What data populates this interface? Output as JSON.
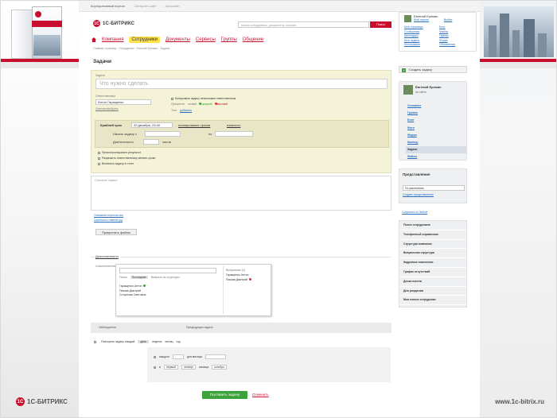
{
  "topbar": [
    "Корпоративный портал",
    "Интернет-сайт",
    "Экстранет"
  ],
  "logo": {
    "badge": "1С",
    "text": "1С-БИТРИКС"
  },
  "search": {
    "placeholder": "поиск сотрудника, документа, прочее",
    "button": "Поиск"
  },
  "nav": [
    "Компания",
    "Сотрудники",
    "Документы",
    "Сервисы",
    "Группы",
    "Общение"
  ],
  "nav_active_index": 1,
  "breadcrumb": "Главная страница · Сотрудники · Евгений Еремин · Задачи",
  "page_title": "Задачи",
  "userbox": {
    "name": "Евгений Еремин",
    "sub1": "Мой портал",
    "sub2": "Выйти",
    "col1": [
      "Мои страницы",
      "Сообщения",
      "Календарь",
      "Мои задачи",
      "Фотографии"
    ],
    "col2": [
      "Блог",
      "Файлы",
      "Группы",
      "Форум",
      "Обновления"
    ]
  },
  "form": {
    "task_label": "Задача",
    "task_placeholder": "Что нужно сделать",
    "responsible_label": "Ответственный",
    "responsible_value": "Антон Гаращенко",
    "responsible_link": "Сменить/выбрать",
    "copy_label": "Копировать задачу нескольким ответственным",
    "priority_label": "Приоритет",
    "priority_low": "низкий",
    "priority_mid": "средний",
    "priority_high": "высокий",
    "tags_label": "Теги",
    "tags_link": "добавить",
    "deadline_label": "Крайний срок",
    "deadline_value": "29 декабря, 23:40",
    "plan_link": "планирование сроков",
    "clear_link": "изменить",
    "start_label": "Начать задачу с",
    "to_label": "по",
    "duration_label": "Длительность",
    "duration_unit": "часов",
    "checkboxes": [
      "Проконтролировать результат",
      "Разрешить ответственному менять сроки",
      "Включить задачу в отчет"
    ]
  },
  "description": {
    "placeholder": "Описание задачи"
  },
  "files": [
    "Описание-портала.doc",
    "Скриншот-главной.jpg"
  ],
  "attach_button": "Прикрепить файлы",
  "extra_title": "Дополнительно",
  "coexec_label": "Соисполнители",
  "picker": {
    "tabs": [
      "Поиск",
      "Последние",
      "Выбрать из структуры"
    ],
    "left": [
      "Гаращенко Антон",
      "Пикова Дмитрий",
      "Сотцегова Светлана"
    ],
    "right_header": "Выбранные (2)",
    "right": [
      "Гаращенко Антон",
      "Пикова Дмитрий"
    ]
  },
  "remind": {
    "observers": "Наблюдатели",
    "prev": "Предыдущая задача"
  },
  "repeat": {
    "label": "Повторять задачу каждый",
    "units": [
      "день",
      "неделю",
      "месяц",
      "год"
    ],
    "row1": [
      "каждого",
      "дня месяца"
    ],
    "row2": [
      "в",
      "первый",
      "четверг",
      "месяца",
      "октябрь"
    ]
  },
  "submit": "Поставить задачу",
  "cancel": "Отменить",
  "right": {
    "create_task": "Создать задачу",
    "profile_name": "Евгений Еремин",
    "profile_status": "на сайте",
    "menu": [
      "Основное",
      "Группы",
      "Блог",
      "Фото",
      "Форум",
      "Календ.",
      "Задачи",
      "Файлы"
    ],
    "menu_current_index": 6,
    "presentation_title": "Представление",
    "presentation_value": "По умолчанию",
    "presentation_link": "Создать представление",
    "save_filter": "Сохранить в Любой",
    "links": [
      "Поиск сотрудников",
      "Телефонный справочник",
      "Структура компании",
      "Визуальная структура",
      "Кадровые изменения",
      "График отсутствий",
      "Доска почета",
      "Дни рождения",
      "Мои новые сотрудники"
    ]
  },
  "footer": {
    "left_text": "1С-БИТРИКС",
    "left_badge": "1С",
    "right_url": "www.1c-bitrix.ru"
  },
  "colors": {
    "brand_red": "#c8102e",
    "nav_active": "#ffe14a",
    "form_bg": "#f4f2d7",
    "success": "#3aa33a",
    "link": "#2a6ebb"
  }
}
